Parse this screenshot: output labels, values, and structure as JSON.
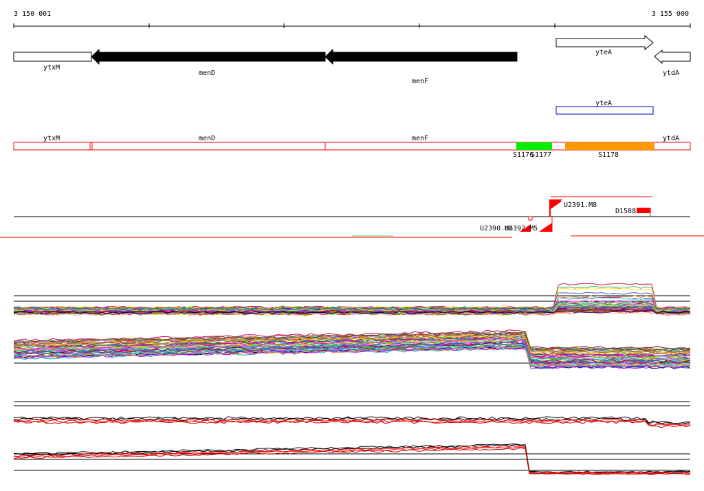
{
  "ruler": {
    "start_label": "3 150 001",
    "end_label": "3 155 000",
    "start": 3150001,
    "end": 3155000
  },
  "genes": [
    {
      "id": "ytxM",
      "label": "ytxM",
      "strand": "+",
      "fill": "white"
    },
    {
      "id": "menD",
      "label": "menD",
      "strand": "-",
      "fill": "black"
    },
    {
      "id": "menF",
      "label": "menF",
      "strand": "-",
      "fill": "black"
    },
    {
      "id": "yteA",
      "label": "yteA",
      "strand": "+",
      "fill": "white"
    },
    {
      "id": "ytdA",
      "label": "ytdA",
      "strand": "-",
      "fill": "white"
    }
  ],
  "operon_label": "yteA",
  "segments": {
    "labels": [
      "ytxM",
      "menD",
      "menF",
      "ytdA"
    ],
    "features": [
      {
        "id": "S1176",
        "label": "S1176",
        "color": "#00ee00"
      },
      {
        "id": "S1177",
        "label": "S1177",
        "color": "#00ee00"
      },
      {
        "id": "S1178",
        "label": "S1178",
        "color": "#ff9900"
      }
    ]
  },
  "promoters": [
    {
      "id": "U2391.M8",
      "label": "U2391.M8"
    },
    {
      "id": "D1588",
      "label": "D1588"
    },
    {
      "id": "U2390.M6",
      "label": "U2390.M6"
    },
    {
      "id": "U2392.M5",
      "label": "U2392.M5"
    }
  ],
  "colors": {
    "segment_outline": "#ff0000",
    "promoter": "#ff0000",
    "operon_box": "#0000cc",
    "feature_green": "#00ee00",
    "feature_orange": "#ff9900"
  }
}
